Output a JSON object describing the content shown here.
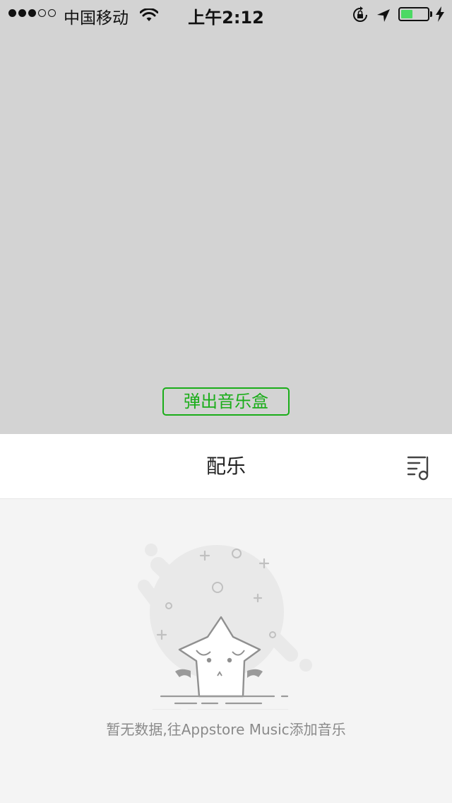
{
  "status_bar": {
    "carrier": "中国移动",
    "time": "上午2:12",
    "signal_bars_filled": 3,
    "signal_bars_total": 5,
    "battery_level_percent": 50,
    "battery_color": "#4cd964",
    "icons": [
      "wifi-icon",
      "rotation-lock-icon",
      "location-arrow-icon",
      "battery-icon",
      "charging-bolt-icon"
    ]
  },
  "main": {
    "popup_button_label": "弹出音乐盒",
    "accent_color": "#1aad19",
    "background_color": "#d3d3d3"
  },
  "music_sheet": {
    "title": "配乐",
    "playlist_icon": "music-playlist-icon",
    "empty_illustration": "sad-star-icon",
    "empty_message": "暂无数据,往Appstore Music添加音乐"
  }
}
